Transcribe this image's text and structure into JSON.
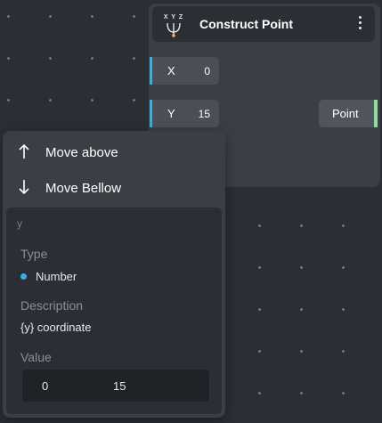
{
  "node": {
    "title": "Construct Point",
    "icon_text": "X Y Z",
    "icon": "xyz-construct-icon",
    "menu_icon": "kebab-menu-icon",
    "inputs": [
      {
        "label": "X",
        "value": "0"
      },
      {
        "label": "Y",
        "value": "15"
      }
    ],
    "output": {
      "label": "Point"
    },
    "colors": {
      "number_socket": "#3aaedd",
      "point_socket": "#8fdc9e"
    }
  },
  "context_menu": {
    "items": [
      {
        "label": "Move above",
        "icon": "arrow-up-icon"
      },
      {
        "label": "Move Bellow",
        "icon": "arrow-down-icon"
      }
    ],
    "inspector": {
      "name": "y",
      "type_label": "Type",
      "type_value": "Number",
      "description_label": "Description",
      "description_value": "{y} coordinate",
      "value_label": "Value",
      "value_parts": [
        "0",
        "15"
      ]
    }
  }
}
